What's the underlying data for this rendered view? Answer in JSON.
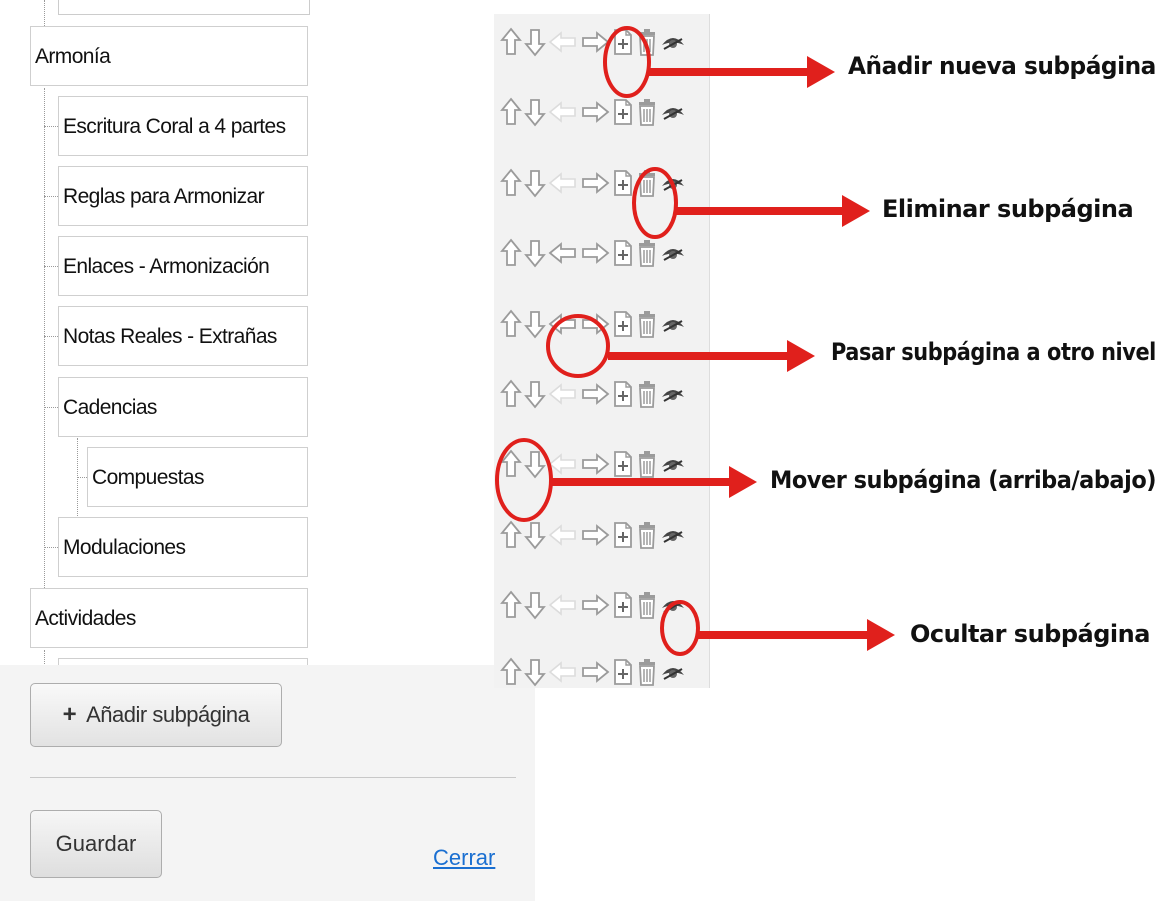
{
  "tree": {
    "nodes": [
      {
        "label": "Armonía",
        "level": 0
      },
      {
        "label": "Escritura Coral a 4 partes",
        "level": 1
      },
      {
        "label": "Reglas para Armonizar",
        "level": 1
      },
      {
        "label": "Enlaces - Armonización",
        "level": 1
      },
      {
        "label": "Notas Reales - Extrañas",
        "level": 1
      },
      {
        "label": "Cadencias",
        "level": 1
      },
      {
        "label": "Compuestas",
        "level": 2
      },
      {
        "label": "Modulaciones",
        "level": 1
      },
      {
        "label": "Actividades",
        "level": 0
      }
    ]
  },
  "footer": {
    "add_subpage_icon": "plus-icon",
    "add_subpage_label": "Añadir subpágina",
    "save_label": "Guardar",
    "close_label": "Cerrar"
  },
  "icon_toolbar": {
    "icons": [
      "arrow-up-icon",
      "arrow-down-icon",
      "arrow-left-icon",
      "arrow-right-icon",
      "add-page-icon",
      "trash-icon",
      "eye-icon"
    ],
    "left_arrow_visible": [
      false,
      false,
      false,
      true,
      true,
      false,
      false,
      false,
      false
    ]
  },
  "callouts": [
    {
      "label": "Añadir nueva subpágina",
      "target": "add-page-icon"
    },
    {
      "label": "Eliminar subpágina",
      "target": "trash-icon"
    },
    {
      "label": "Pasar subpágina a otro nivel",
      "target": "arrow-left-right-icons"
    },
    {
      "label": "Mover subpágina (arriba/abajo)",
      "target": "arrow-up-down-icons"
    },
    {
      "label": "Ocultar subpágina",
      "target": "eye-icon"
    }
  ],
  "colors": {
    "callout_red": "#e0201c",
    "link_blue": "#1a6fd1",
    "icon_gray": "#9b9b9b"
  }
}
